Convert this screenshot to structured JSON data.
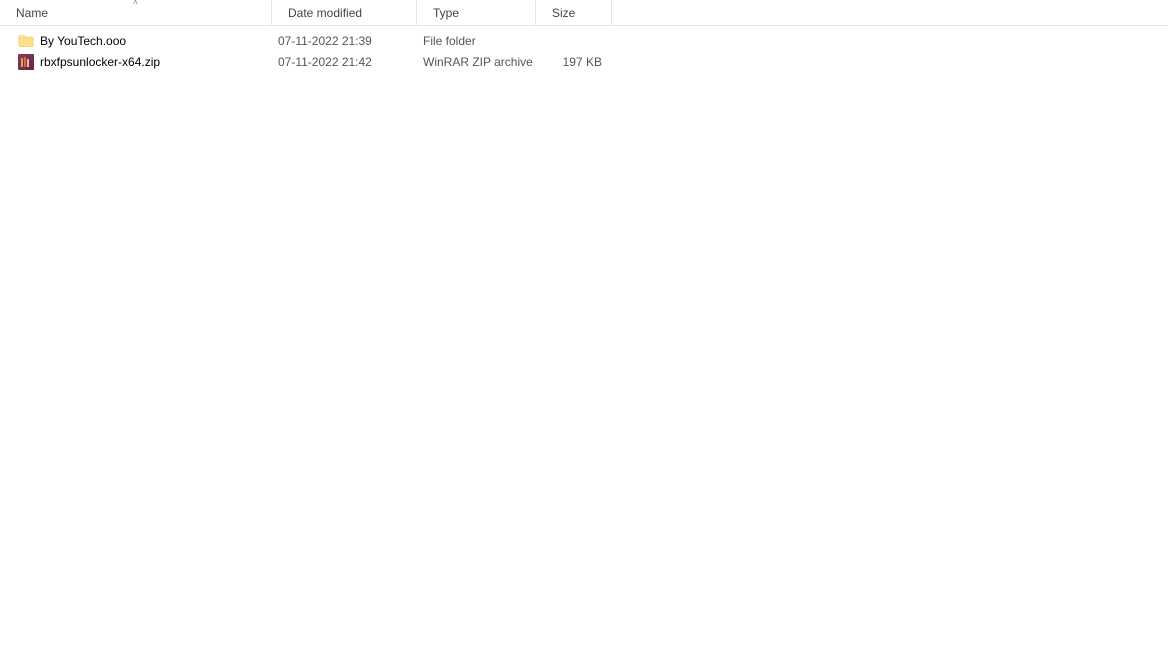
{
  "columns": {
    "name": "Name",
    "date_modified": "Date modified",
    "type": "Type",
    "size": "Size"
  },
  "sort": {
    "column": "name",
    "direction": "asc",
    "indicator": "˄"
  },
  "items": [
    {
      "icon": "folder",
      "name": "By YouTech.ooo",
      "date_modified": "07-11-2022 21:39",
      "type": "File folder",
      "size": ""
    },
    {
      "icon": "zip",
      "name": "rbxfpsunlocker-x64.zip",
      "date_modified": "07-11-2022 21:42",
      "type": "WinRAR ZIP archive",
      "size": "197 KB"
    }
  ]
}
